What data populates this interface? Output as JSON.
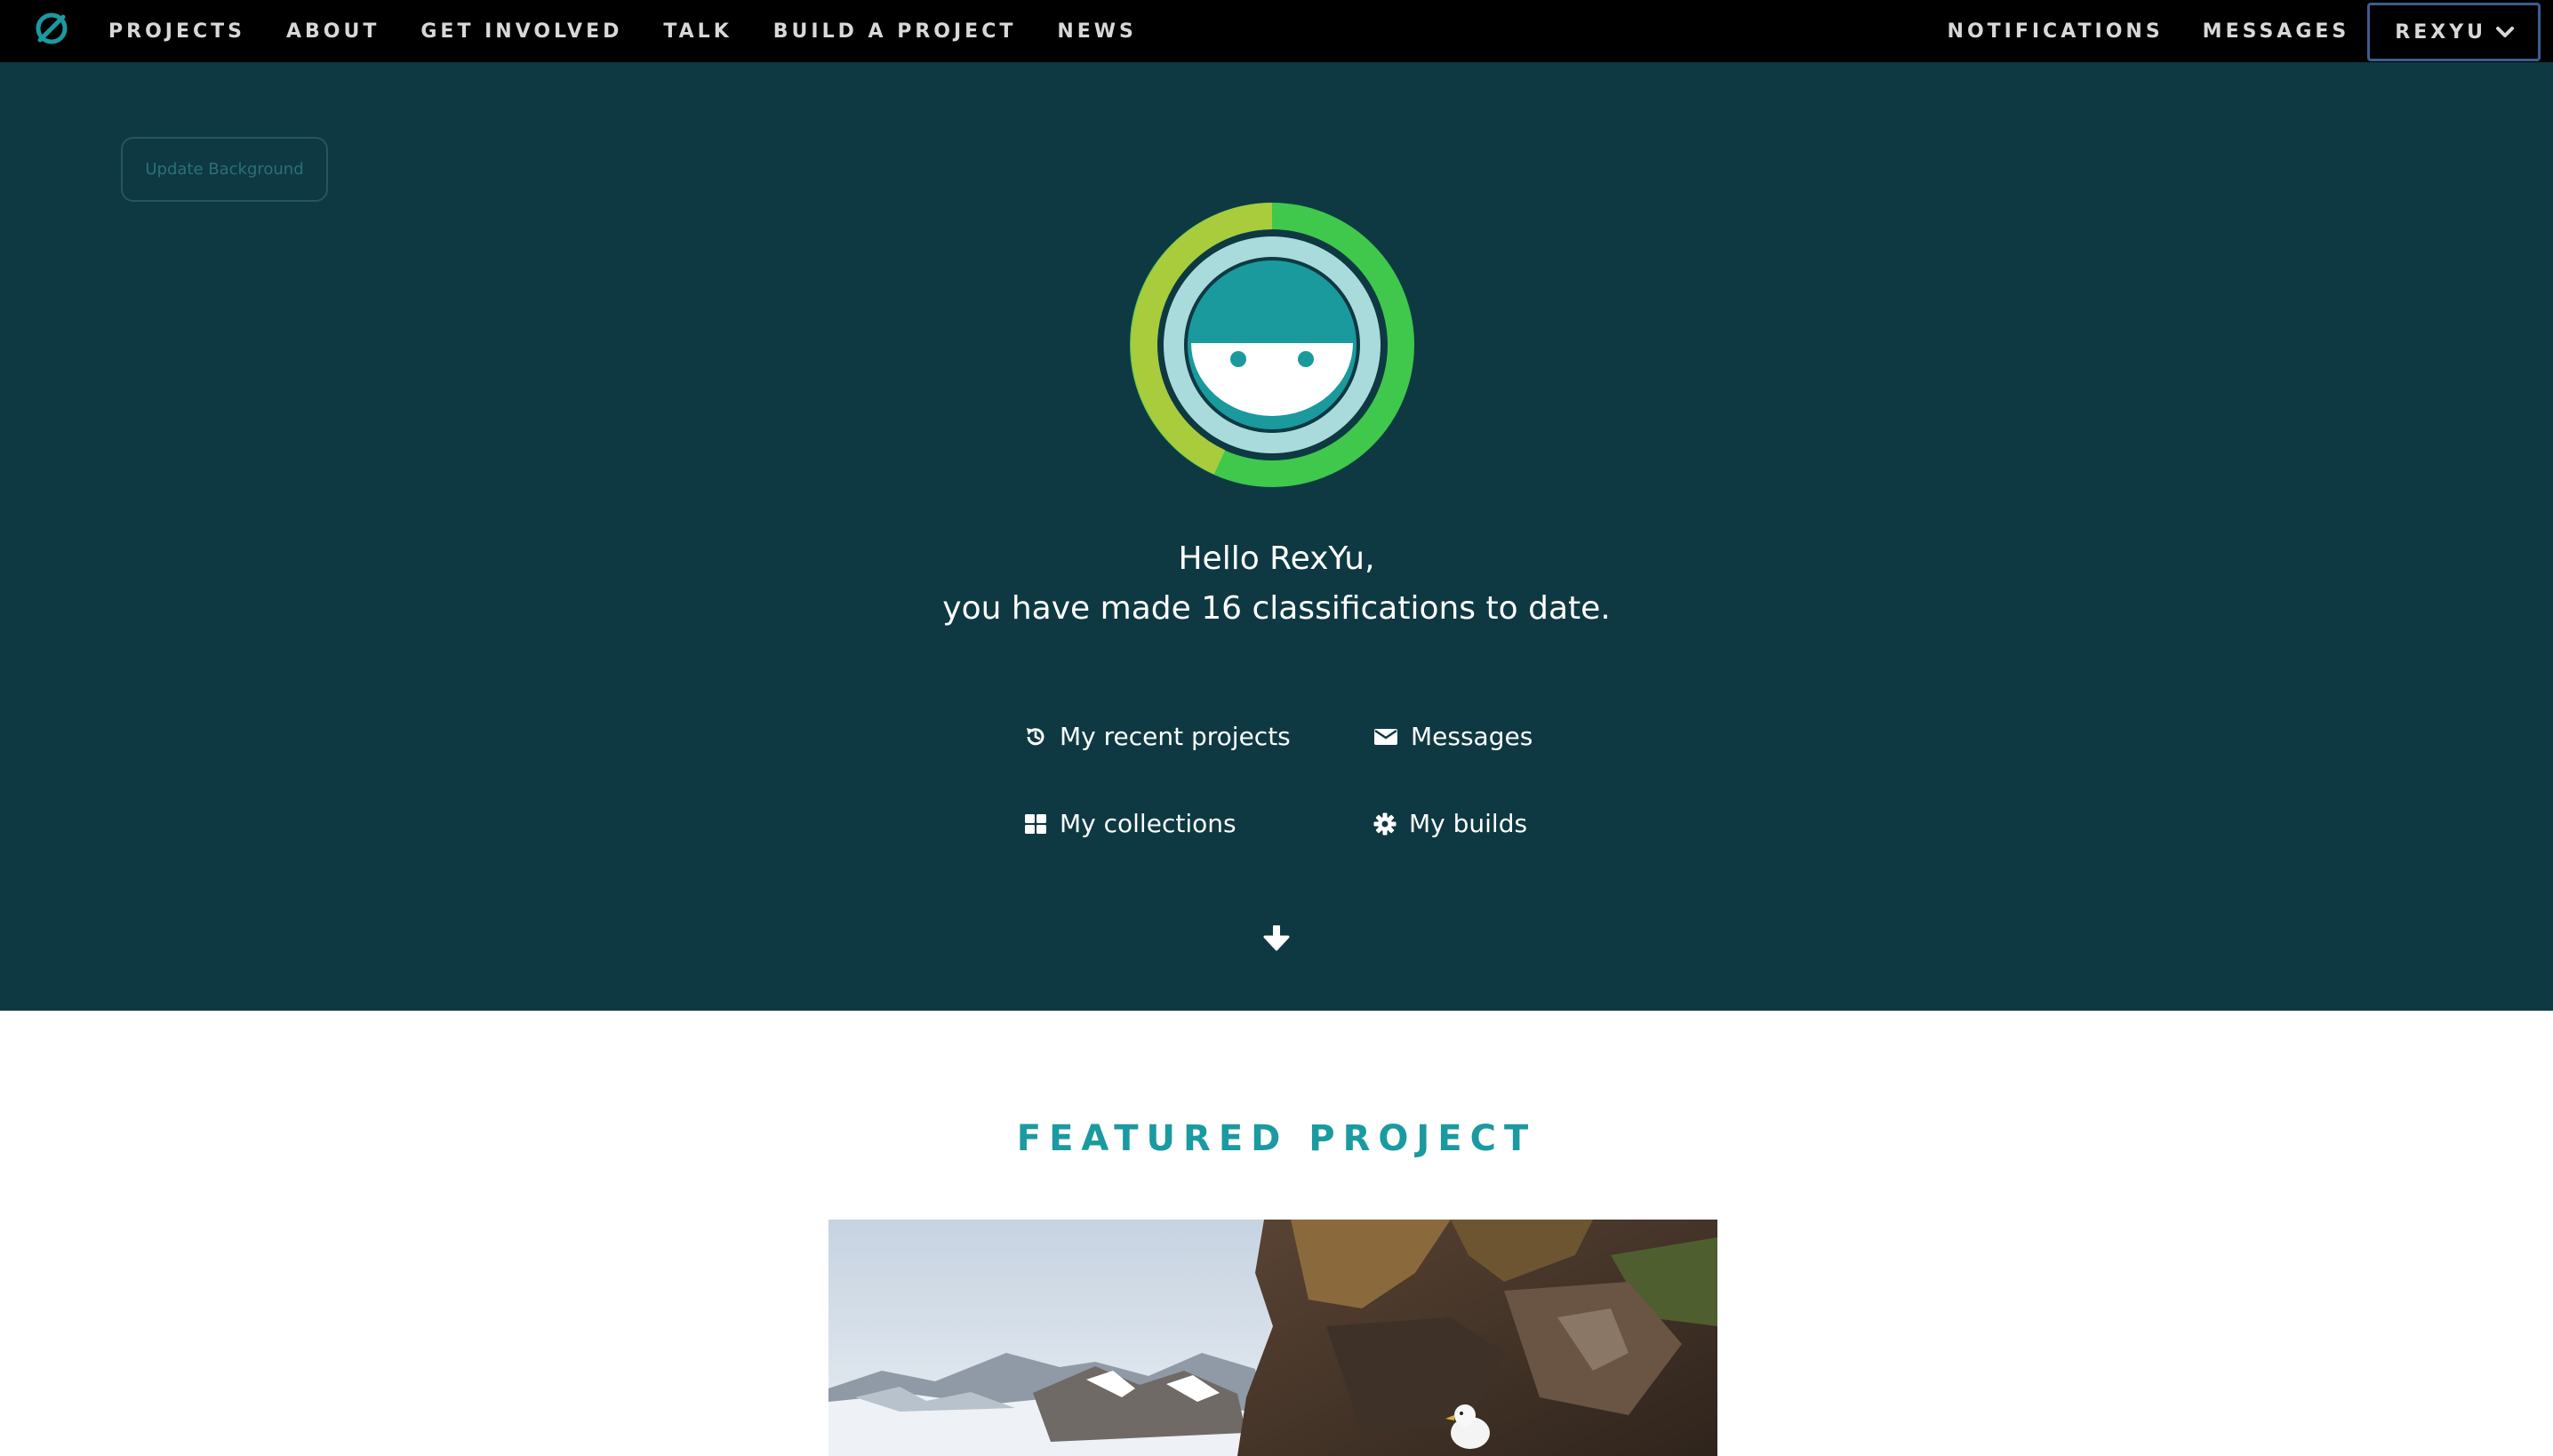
{
  "nav": {
    "logo_icon": "zooniverse-logo-icon",
    "left_links": [
      "PROJECTS",
      "ABOUT",
      "GET INVOLVED",
      "TALK",
      "BUILD A PROJECT",
      "NEWS"
    ],
    "notifications": "NOTIFICATIONS",
    "messages": "MESSAGES",
    "username": "REXYU",
    "user_menu_icon": "chevron-down-icon"
  },
  "hero": {
    "update_background_label": "Update Background",
    "greeting_line1": "Hello RexYu,",
    "greeting_line2": "you have made 16 classifications to date.",
    "links": {
      "recent_projects": "My recent projects",
      "messages": "Messages",
      "collections": "My collections",
      "builds": "My builds"
    },
    "icons": {
      "recent_projects": "history-icon",
      "messages": "envelope-icon",
      "collections": "grid-icon",
      "builds": "gear-icon",
      "scroll": "arrow-down-icon"
    }
  },
  "featured": {
    "title": "FEATURED PROJECT"
  },
  "colors": {
    "nav_bg": "#000000",
    "hero_bg": "#0e3942",
    "accent_teal": "#1b9aa0",
    "ring_lime": "#a8cc3c",
    "ring_green": "#3fc84c",
    "user_menu_border": "#3c5d8f"
  }
}
